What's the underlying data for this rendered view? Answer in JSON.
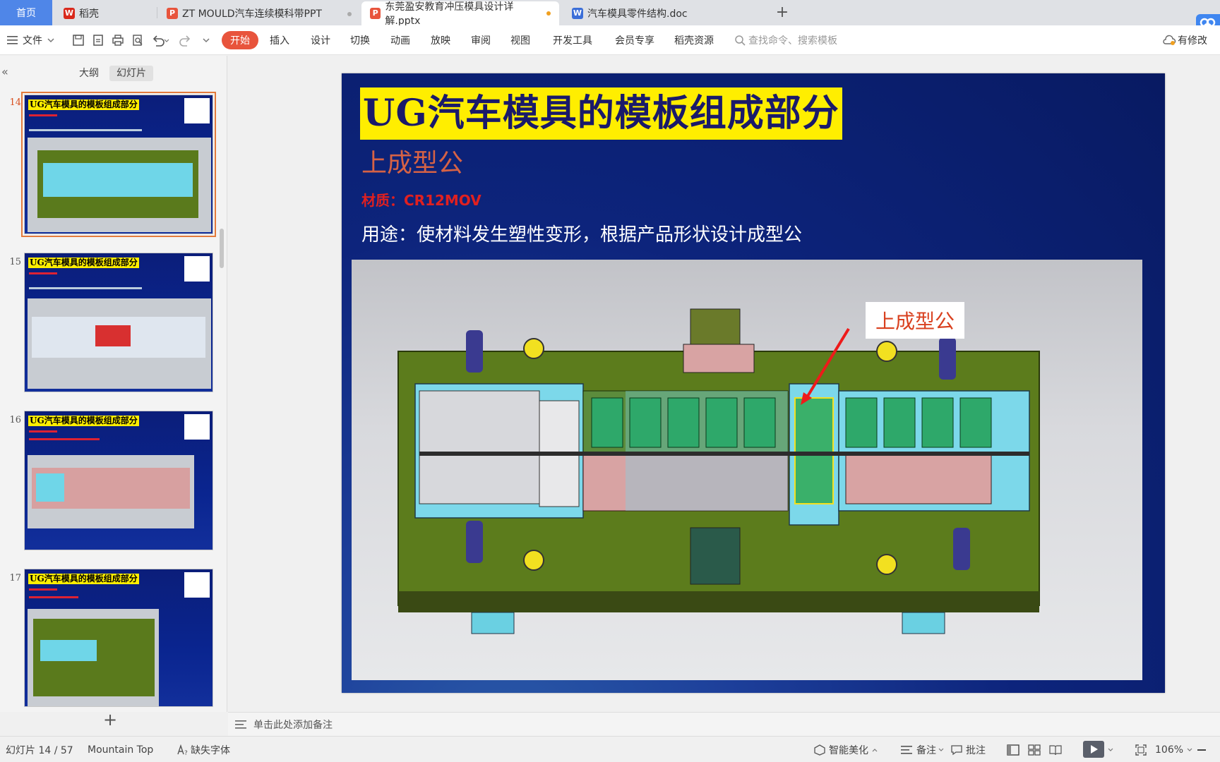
{
  "tabs": {
    "home": "首页",
    "items": [
      {
        "label": "稻壳",
        "icon": "docer-icon",
        "color": "#d9291c"
      },
      {
        "label": "ZT MOULD汽车连续模科带PPT",
        "icon": "ppt-icon",
        "color": "#e8543c"
      },
      {
        "label": "东莞盈安教育冲压模具设计详解.pptx",
        "icon": "ppt-icon",
        "color": "#e8543c"
      },
      {
        "label": "汽车模具零件结构.doc",
        "icon": "word-icon",
        "color": "#3b6ed8"
      }
    ],
    "new_tab": "+"
  },
  "ribbon": {
    "file": "文件",
    "start": "开始",
    "menus": [
      "插入",
      "设计",
      "切换",
      "动画",
      "放映",
      "审阅",
      "视图",
      "开发工具",
      "会员专享",
      "稻壳资源"
    ],
    "search_placeholder": "查找命令、搜索模板",
    "modified": "有修改"
  },
  "left_panel": {
    "view_tabs": [
      "大纲",
      "幻灯片"
    ],
    "slides": [
      {
        "num": "14",
        "title": "UG汽车模具的模板组成部分"
      },
      {
        "num": "15",
        "title": "UG汽车模具的模板组成部分"
      },
      {
        "num": "16",
        "title": "UG汽车模具的模板组成部分"
      },
      {
        "num": "17",
        "title": "UG汽车模具的模板组成部分"
      }
    ],
    "add_slide": "+"
  },
  "slide": {
    "title": "UG汽车模具的模板组成部分",
    "subtitle": "上成型公",
    "material": "材质：CR12MOV",
    "usage": "用途：使材料发生塑性变形，根据产品形状设计成型公",
    "callout": "上成型公"
  },
  "notes_placeholder": "单击此处添加备注",
  "status": {
    "slide_pos": "幻灯片 14 / 57",
    "theme": "Mountain Top",
    "missing_font": "缺失字体",
    "beautify": "智能美化",
    "notes": "备注",
    "comments": "批注",
    "zoom": "106%"
  },
  "colors": {
    "accent": "#e8543c",
    "home_tab": "#4f86e8",
    "slide_bg": "#0d247c",
    "title_bg": "#ffee00"
  }
}
